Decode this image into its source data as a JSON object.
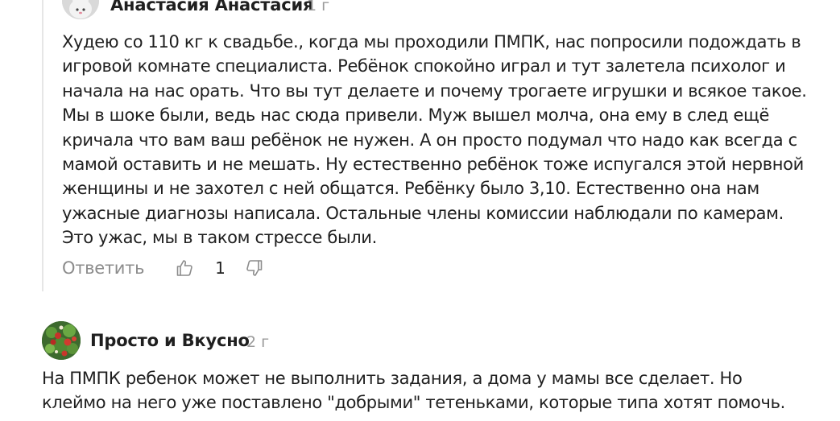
{
  "comments": [
    {
      "author": "Анастасия Анастасия",
      "age": "1 г",
      "text": "Худею со 110 кг к свадьбе., когда мы проходили ПМПК, нас попросили подождать в\nигровой комнате специалиста. Ребёнок спокойно играл и тут залетела психолог и\nначала на нас орать. Что вы тут делаете и почему трогаете игрушки и всякое такое.\nМы в шоке были, ведь нас сюда привели. Муж вышел молча, она ему в след ещё\nкричала что вам ваш ребёнок не нужен. А он просто подумал что надо как всегда с\nмамой оставить и не мешать. Ну естественно ребёнок тоже испугался этой нервной\nженщины и не захотел с ней общатся. Ребёнку было 3,10. Естественно она нам\nужасные диагнозы написала. Остальные члены комиссии наблюдали по камерам.\nЭто ужас, мы в таком стрессе были.",
      "reply_label": "Ответить",
      "like_count": "1",
      "avatar_icon": "bunny-avatar-icon",
      "like_icon": "thumb-up-icon",
      "dislike_icon": "thumb-down-icon"
    },
    {
      "author": "Просто и Вкусно",
      "age": "2 г",
      "text": "На ПМПК ребенок может не выполнить задания, а дома у мамы все сделает. Но\nклеймо на него уже поставлено \"добрыми\" тетеньками, которые типа хотят помочь.",
      "avatar_icon": "salad-avatar-icon"
    }
  ],
  "colors": {
    "text": "#1f1f1f",
    "muted": "#8c8c8c",
    "age": "#9a9a9a",
    "thread_line": "#e6e6e6",
    "icon_stroke": "#8c8c8c"
  }
}
